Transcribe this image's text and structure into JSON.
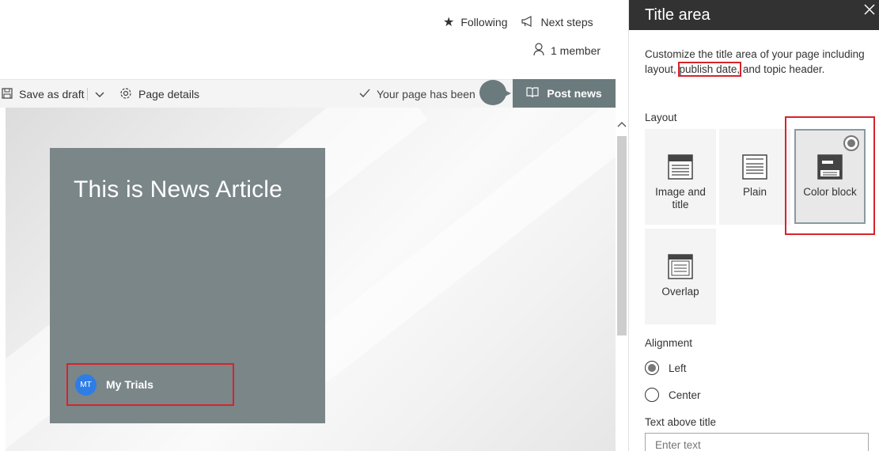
{
  "header": {
    "following_label": "Following",
    "next_steps_label": "Next steps",
    "member_label": "1 member"
  },
  "commandbar": {
    "save_draft_label": "Save as draft",
    "page_details_label": "Page details",
    "status_text": "Your page has been s",
    "post_news_label": "Post news"
  },
  "canvas": {
    "article_title": "This is News Article",
    "author_initials": "MT",
    "author_name": "My Trials"
  },
  "panel": {
    "title": "Title area",
    "description_pre": "Customize the title area of your page including layout, ",
    "description_highlight": "publish date,",
    "description_post": " and topic header.",
    "layout_label": "Layout",
    "layouts": [
      {
        "label": "Image and title"
      },
      {
        "label": "Plain"
      },
      {
        "label": "Color block",
        "selected": true
      },
      {
        "label": "Overlap"
      }
    ],
    "alignment_label": "Alignment",
    "alignments": [
      {
        "label": "Left",
        "selected": true
      },
      {
        "label": "Center",
        "selected": false
      }
    ],
    "text_above_title_label": "Text above title",
    "text_above_title_placeholder": "Enter text"
  },
  "colors": {
    "accent": "#6b7a7d",
    "title_card": "#7b8689",
    "highlight": "#d8232a",
    "avatar": "#2e7de6",
    "panel_header": "#323232"
  }
}
